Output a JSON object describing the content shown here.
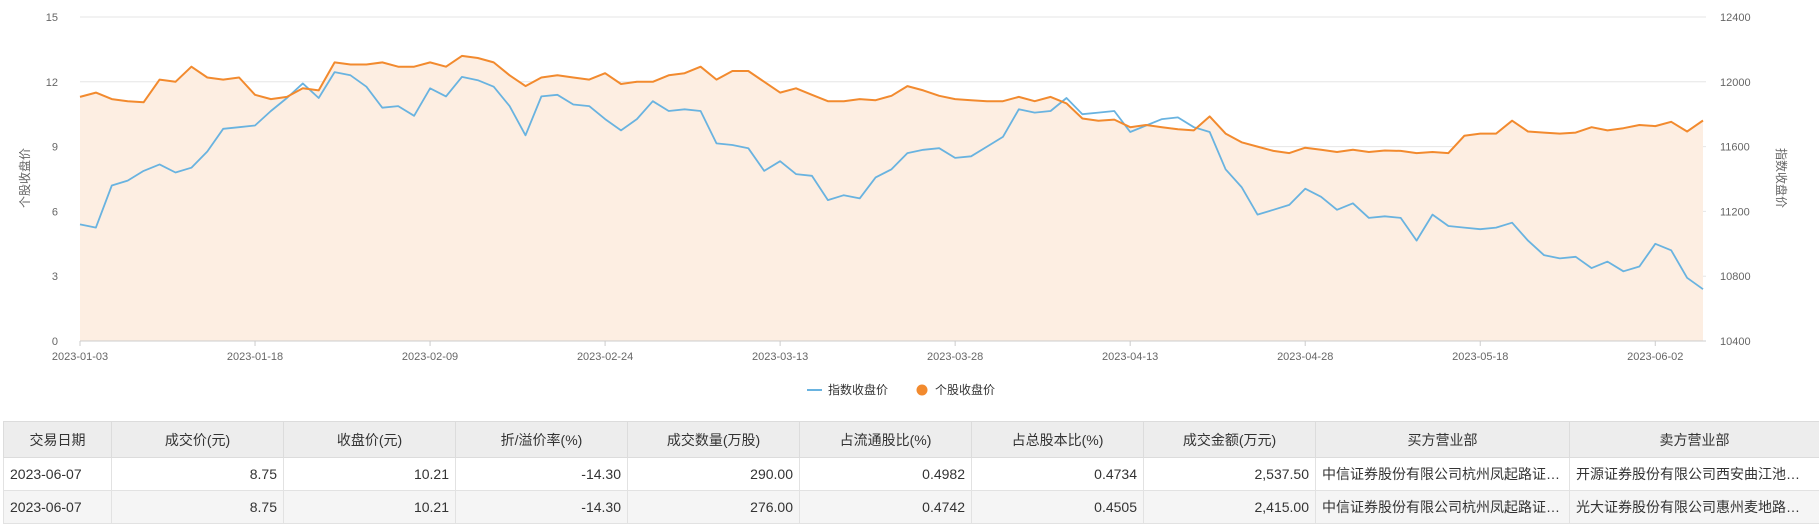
{
  "chart_data": {
    "type": "line",
    "ylabel_left": "个股收盘价",
    "ylabel_right": "指数收盘价",
    "ylim_left": [
      0,
      15
    ],
    "yticks_left": [
      "0",
      "3",
      "6",
      "9",
      "12",
      "15"
    ],
    "ylim_right": [
      10400,
      12400
    ],
    "yticks_right": [
      "10400",
      "10800",
      "11200",
      "11600",
      "12000",
      "12400"
    ],
    "x_tick_labels": [
      "2023-01-03",
      "2023-01-18",
      "2023-02-09",
      "2023-02-24",
      "2023-03-13",
      "2023-03-28",
      "2023-04-13",
      "2023-04-28",
      "2023-05-18",
      "2023-06-02"
    ],
    "x_tick_index": [
      0,
      11,
      22,
      33,
      44,
      55,
      66,
      77,
      88,
      99
    ],
    "grid": true,
    "legend_position": "bottom",
    "colors": {
      "index": "#69b3e0",
      "stock": "#f28a2e",
      "area": "#fdeee2"
    },
    "series": [
      {
        "name": "指数收盘价",
        "axis": "right",
        "values": [
          11120,
          11100,
          11360,
          11390,
          11450,
          11490,
          11440,
          11470,
          11570,
          11710,
          11720,
          11730,
          11820,
          11900,
          11990,
          11900,
          12060,
          12040,
          11970,
          11840,
          11850,
          11790,
          11960,
          11910,
          12030,
          12010,
          11970,
          11850,
          11670,
          11910,
          11920,
          11860,
          11850,
          11770,
          11700,
          11770,
          11880,
          11820,
          11830,
          11820,
          11620,
          11610,
          11590,
          11450,
          11510,
          11430,
          11420,
          11270,
          11300,
          11280,
          11410,
          11460,
          11560,
          11580,
          11590,
          11530,
          11540,
          11600,
          11660,
          11830,
          11810,
          11820,
          11900,
          11800,
          11810,
          11820,
          11690,
          11730,
          11770,
          11780,
          11720,
          11690,
          11460,
          11350,
          11180,
          11210,
          11240,
          11340,
          11290,
          11210,
          11250,
          11160,
          11170,
          11160,
          11020,
          11180,
          11110,
          11100,
          11090,
          11100,
          11130,
          11020,
          10930,
          10910,
          10920,
          10850,
          10890,
          10830,
          10860,
          11000,
          10960,
          10790,
          10720
        ]
      },
      {
        "name": "个股收盘价",
        "axis": "left",
        "values": [
          11.3,
          11.5,
          11.2,
          11.1,
          11.05,
          12.1,
          12.0,
          12.7,
          12.2,
          12.1,
          12.2,
          11.4,
          11.2,
          11.3,
          11.7,
          11.6,
          12.9,
          12.8,
          12.8,
          12.9,
          12.7,
          12.7,
          12.9,
          12.7,
          13.2,
          13.1,
          12.9,
          12.3,
          11.8,
          12.2,
          12.3,
          12.2,
          12.1,
          12.4,
          11.9,
          12.0,
          12.0,
          12.3,
          12.4,
          12.7,
          12.1,
          12.5,
          12.5,
          12.0,
          11.5,
          11.7,
          11.4,
          11.1,
          11.1,
          11.2,
          11.15,
          11.35,
          11.8,
          11.6,
          11.35,
          11.2,
          11.15,
          11.1,
          11.1,
          11.3,
          11.1,
          11.3,
          11.0,
          10.3,
          10.2,
          10.25,
          9.9,
          10.0,
          9.9,
          9.8,
          9.75,
          10.4,
          9.6,
          9.2,
          9.0,
          8.8,
          8.7,
          8.95,
          8.85,
          8.75,
          8.85,
          8.75,
          8.82,
          8.8,
          8.7,
          8.75,
          8.7,
          9.5,
          9.6,
          9.6,
          10.2,
          9.7,
          9.65,
          9.6,
          9.65,
          9.9,
          9.75,
          9.85,
          10.0,
          9.95,
          10.15,
          9.7,
          10.21
        ]
      }
    ]
  },
  "legend": [
    {
      "label": "指数收盘价",
      "marker": "line",
      "color": "#69b3e0"
    },
    {
      "label": "个股收盘价",
      "marker": "circle",
      "color": "#f28a2e"
    }
  ],
  "table": {
    "headers": [
      "交易日期",
      "成交价(元)",
      "收盘价(元)",
      "折/溢价率(%)",
      "成交数量(万股)",
      "占流通股比(%)",
      "占总股本比(%)",
      "成交金额(万元)",
      "买方营业部",
      "卖方营业部"
    ],
    "rows": [
      [
        "2023-06-07",
        "8.75",
        "10.21",
        "-14.30",
        "290.00",
        "0.4982",
        "0.4734",
        "2,537.50",
        "中信证券股份有限公司杭州凤起路证券营业部",
        "开源证券股份有限公司西安曲江池东路证券营业部"
      ],
      [
        "2023-06-07",
        "8.75",
        "10.21",
        "-14.30",
        "276.00",
        "0.4742",
        "0.4505",
        "2,415.00",
        "中信证券股份有限公司杭州凤起路证券营业部",
        "光大证券股份有限公司惠州麦地路证券营业部"
      ]
    ]
  }
}
